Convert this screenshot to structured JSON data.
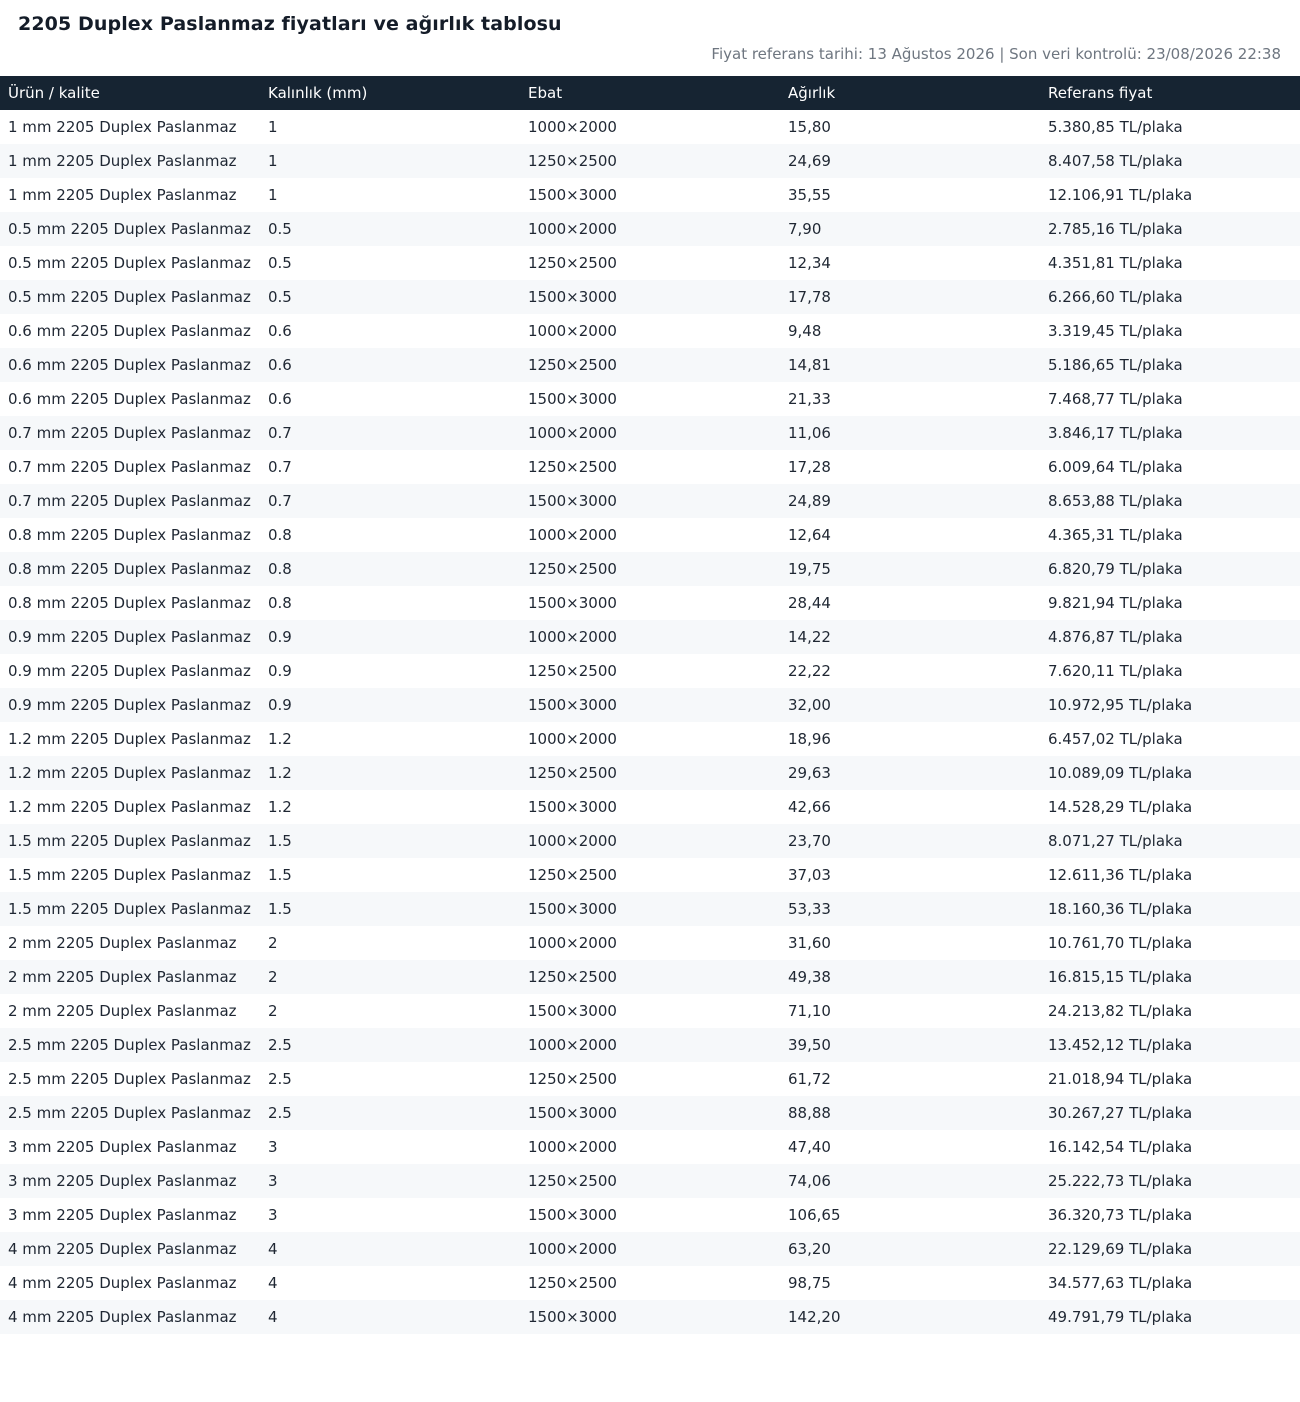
{
  "page": {
    "title": "2205 Duplex Paslanmaz fiyatları ve ağırlık tablosu",
    "meta": "Fiyat referans tarihi: 13 Ağustos 2026 | Son veri kontrolü: 23/08/2026 22:38"
  },
  "table": {
    "headers": [
      "Ürün / kalite",
      "Kalınlık (mm)",
      "Ebat",
      "Ağırlık",
      "Referans fiyat"
    ],
    "rows": [
      [
        "1 mm 2205 Duplex Paslanmaz",
        "1",
        "1000×2000",
        "15,80",
        "5.380,85 TL/plaka"
      ],
      [
        "1 mm 2205 Duplex Paslanmaz",
        "1",
        "1250×2500",
        "24,69",
        "8.407,58 TL/plaka"
      ],
      [
        "1 mm 2205 Duplex Paslanmaz",
        "1",
        "1500×3000",
        "35,55",
        "12.106,91 TL/plaka"
      ],
      [
        "0.5 mm 2205 Duplex Paslanmaz",
        "0.5",
        "1000×2000",
        "7,90",
        "2.785,16 TL/plaka"
      ],
      [
        "0.5 mm 2205 Duplex Paslanmaz",
        "0.5",
        "1250×2500",
        "12,34",
        "4.351,81 TL/plaka"
      ],
      [
        "0.5 mm 2205 Duplex Paslanmaz",
        "0.5",
        "1500×3000",
        "17,78",
        "6.266,60 TL/plaka"
      ],
      [
        "0.6 mm 2205 Duplex Paslanmaz",
        "0.6",
        "1000×2000",
        "9,48",
        "3.319,45 TL/plaka"
      ],
      [
        "0.6 mm 2205 Duplex Paslanmaz",
        "0.6",
        "1250×2500",
        "14,81",
        "5.186,65 TL/plaka"
      ],
      [
        "0.6 mm 2205 Duplex Paslanmaz",
        "0.6",
        "1500×3000",
        "21,33",
        "7.468,77 TL/plaka"
      ],
      [
        "0.7 mm 2205 Duplex Paslanmaz",
        "0.7",
        "1000×2000",
        "11,06",
        "3.846,17 TL/plaka"
      ],
      [
        "0.7 mm 2205 Duplex Paslanmaz",
        "0.7",
        "1250×2500",
        "17,28",
        "6.009,64 TL/plaka"
      ],
      [
        "0.7 mm 2205 Duplex Paslanmaz",
        "0.7",
        "1500×3000",
        "24,89",
        "8.653,88 TL/plaka"
      ],
      [
        "0.8 mm 2205 Duplex Paslanmaz",
        "0.8",
        "1000×2000",
        "12,64",
        "4.365,31 TL/plaka"
      ],
      [
        "0.8 mm 2205 Duplex Paslanmaz",
        "0.8",
        "1250×2500",
        "19,75",
        "6.820,79 TL/plaka"
      ],
      [
        "0.8 mm 2205 Duplex Paslanmaz",
        "0.8",
        "1500×3000",
        "28,44",
        "9.821,94 TL/plaka"
      ],
      [
        "0.9 mm 2205 Duplex Paslanmaz",
        "0.9",
        "1000×2000",
        "14,22",
        "4.876,87 TL/plaka"
      ],
      [
        "0.9 mm 2205 Duplex Paslanmaz",
        "0.9",
        "1250×2500",
        "22,22",
        "7.620,11 TL/plaka"
      ],
      [
        "0.9 mm 2205 Duplex Paslanmaz",
        "0.9",
        "1500×3000",
        "32,00",
        "10.972,95 TL/plaka"
      ],
      [
        "1.2 mm 2205 Duplex Paslanmaz",
        "1.2",
        "1000×2000",
        "18,96",
        "6.457,02 TL/plaka"
      ],
      [
        "1.2 mm 2205 Duplex Paslanmaz",
        "1.2",
        "1250×2500",
        "29,63",
        "10.089,09 TL/plaka"
      ],
      [
        "1.2 mm 2205 Duplex Paslanmaz",
        "1.2",
        "1500×3000",
        "42,66",
        "14.528,29 TL/plaka"
      ],
      [
        "1.5 mm 2205 Duplex Paslanmaz",
        "1.5",
        "1000×2000",
        "23,70",
        "8.071,27 TL/plaka"
      ],
      [
        "1.5 mm 2205 Duplex Paslanmaz",
        "1.5",
        "1250×2500",
        "37,03",
        "12.611,36 TL/plaka"
      ],
      [
        "1.5 mm 2205 Duplex Paslanmaz",
        "1.5",
        "1500×3000",
        "53,33",
        "18.160,36 TL/plaka"
      ],
      [
        "2 mm 2205 Duplex Paslanmaz",
        "2",
        "1000×2000",
        "31,60",
        "10.761,70 TL/plaka"
      ],
      [
        "2 mm 2205 Duplex Paslanmaz",
        "2",
        "1250×2500",
        "49,38",
        "16.815,15 TL/plaka"
      ],
      [
        "2 mm 2205 Duplex Paslanmaz",
        "2",
        "1500×3000",
        "71,10",
        "24.213,82 TL/plaka"
      ],
      [
        "2.5 mm 2205 Duplex Paslanmaz",
        "2.5",
        "1000×2000",
        "39,50",
        "13.452,12 TL/plaka"
      ],
      [
        "2.5 mm 2205 Duplex Paslanmaz",
        "2.5",
        "1250×2500",
        "61,72",
        "21.018,94 TL/plaka"
      ],
      [
        "2.5 mm 2205 Duplex Paslanmaz",
        "2.5",
        "1500×3000",
        "88,88",
        "30.267,27 TL/plaka"
      ],
      [
        "3 mm 2205 Duplex Paslanmaz",
        "3",
        "1000×2000",
        "47,40",
        "16.142,54 TL/plaka"
      ],
      [
        "3 mm 2205 Duplex Paslanmaz",
        "3",
        "1250×2500",
        "74,06",
        "25.222,73 TL/plaka"
      ],
      [
        "3 mm 2205 Duplex Paslanmaz",
        "3",
        "1500×3000",
        "106,65",
        "36.320,73 TL/plaka"
      ],
      [
        "4 mm 2205 Duplex Paslanmaz",
        "4",
        "1000×2000",
        "63,20",
        "22.129,69 TL/plaka"
      ],
      [
        "4 mm 2205 Duplex Paslanmaz",
        "4",
        "1250×2500",
        "98,75",
        "34.577,63 TL/plaka"
      ],
      [
        "4 mm 2205 Duplex Paslanmaz",
        "4",
        "1500×3000",
        "142,20",
        "49.791,79 TL/plaka"
      ]
    ]
  },
  "colors": {
    "header_background": "#162432",
    "row_stripe": "#f6f8fa",
    "meta_text": "#6e7680"
  }
}
